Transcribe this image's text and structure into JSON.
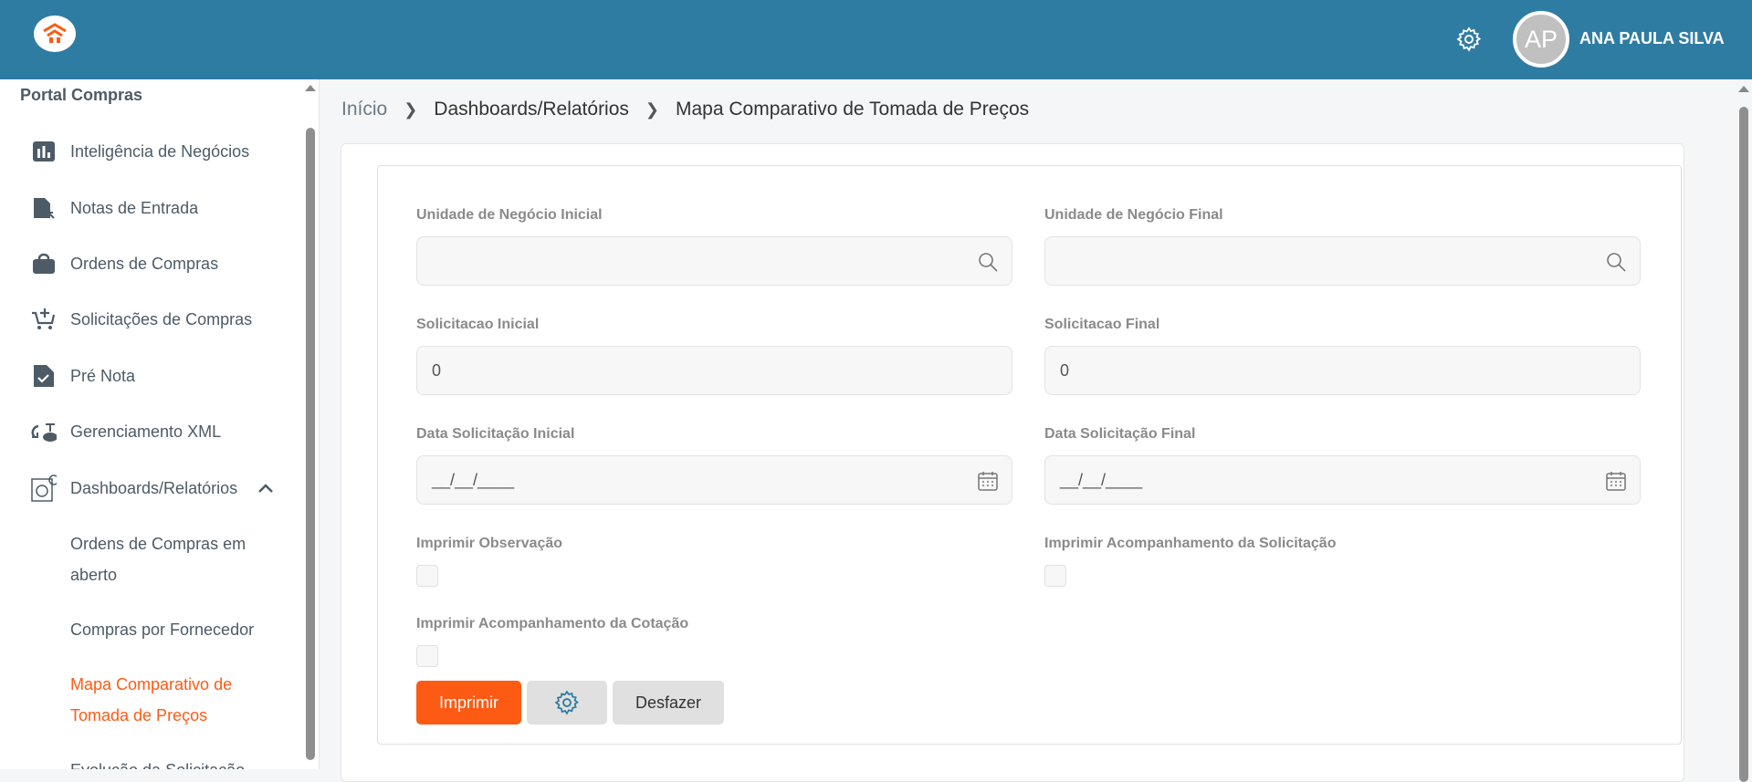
{
  "header": {
    "user_initials": "AP",
    "user_name": "ANA PAULA SILVA"
  },
  "sidebar": {
    "title": "Portal Compras",
    "items": [
      {
        "label": "Inteligência de Negócios",
        "icon": "bar-chart-icon"
      },
      {
        "label": "Notas de Entrada",
        "icon": "document-arrow-icon"
      },
      {
        "label": "Ordens de Compras",
        "icon": "shopping-bag-icon"
      },
      {
        "label": "Solicitações de Compras",
        "icon": "cart-plus-icon"
      },
      {
        "label": "Pré Nota",
        "icon": "document-check-icon"
      },
      {
        "label": "Gerenciamento XML",
        "icon": "cloud-sync-icon"
      },
      {
        "label": "Dashboards/Relatórios",
        "icon": "dashboard-search-icon"
      }
    ],
    "subitems": [
      {
        "label": "Ordens de Compras em aberto"
      },
      {
        "label": "Compras por Fornecedor"
      },
      {
        "label": "Mapa Comparativo de Tomada de Preços",
        "active": true
      },
      {
        "label": "Evolução da Solicitação"
      }
    ]
  },
  "breadcrumb": [
    "Início",
    "Dashboards/Relatórios",
    "Mapa Comparativo de Tomada de Preços"
  ],
  "form": {
    "unidade_inicial": {
      "label": "Unidade de Negócio Inicial",
      "value": ""
    },
    "unidade_final": {
      "label": "Unidade de Negócio Final",
      "value": ""
    },
    "solicitacao_inicial": {
      "label": "Solicitacao Inicial",
      "value": "0"
    },
    "solicitacao_final": {
      "label": "Solicitacao Final",
      "value": "0"
    },
    "data_inicial": {
      "label": "Data Solicitação Inicial",
      "value": "__/__/____"
    },
    "data_final": {
      "label": "Data Solicitação Final",
      "value": "__/__/____"
    },
    "imprimir_obs": {
      "label": "Imprimir Observação",
      "checked": false
    },
    "imprimir_acomp_sol": {
      "label": "Imprimir Acompanhamento da Solicitação",
      "checked": false
    },
    "imprimir_acomp_cot": {
      "label": "Imprimir Acompanhamento da Cotação",
      "checked": false
    }
  },
  "buttons": {
    "print": "Imprimir",
    "undo": "Desfazer"
  },
  "colors": {
    "header": "#2f7ca3",
    "accent": "#fd5a14"
  }
}
